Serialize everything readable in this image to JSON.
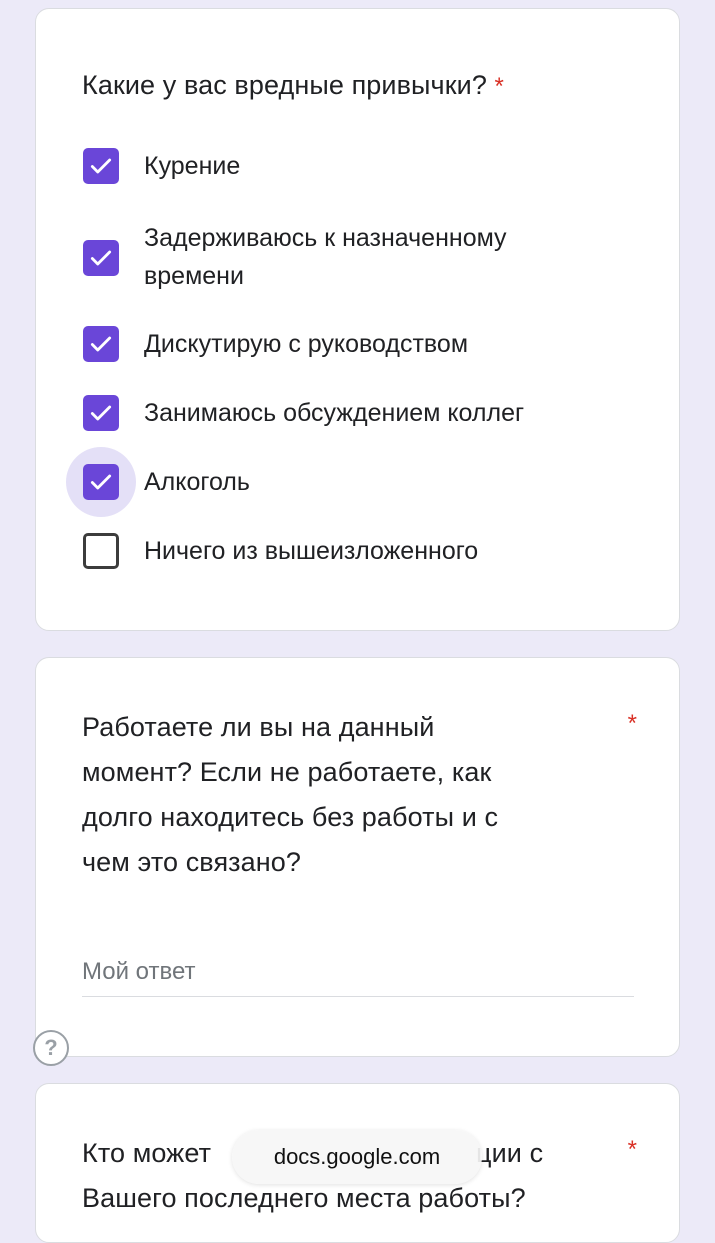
{
  "questions": [
    {
      "title": "Какие у вас вредные привычки?",
      "required_mark": "*",
      "options": [
        {
          "label": "Курение",
          "checked": true
        },
        {
          "label": "Задерживаюсь к назначенному",
          "label_line2": "времени",
          "checked": true
        },
        {
          "label": "Дискутирую с руководством",
          "checked": true
        },
        {
          "label": "Занимаюсь обсуждением коллег",
          "checked": true
        },
        {
          "label": "Алкоголь",
          "checked": true,
          "focused": true
        },
        {
          "label": "Ничего из вышеизложенного",
          "checked": false
        }
      ]
    },
    {
      "title_lines": [
        "Работаете ли вы на данный",
        "момент? Если не работаете, как",
        "долго находитесь без работы и с",
        "чем это связано?"
      ],
      "required_mark": "*",
      "answer_placeholder": "Мой ответ"
    },
    {
      "title_line1_left": "Кто может",
      "title_line1_right": "ции с",
      "title_line2": "Вашего последнего места работы?",
      "required_mark": "*"
    }
  ],
  "help_icon": "?",
  "url_bar": {
    "text": "docs.google.com"
  },
  "colors": {
    "background": "#ECEAF8",
    "checkbox_accent": "#6A46D8",
    "required": "#d93025"
  }
}
